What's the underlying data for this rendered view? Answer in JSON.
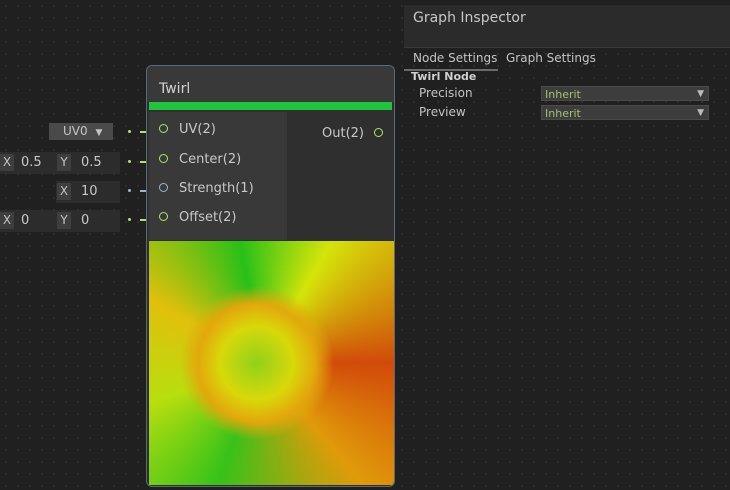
{
  "node": {
    "title": "Twirl",
    "inputs": [
      {
        "label": "UV(2)"
      },
      {
        "label": "Center(2)"
      },
      {
        "label": "Strength(1)"
      },
      {
        "label": "Offset(2)"
      }
    ],
    "output": {
      "label": "Out(2)"
    }
  },
  "inline_inputs": {
    "uv_dropdown": "UV0",
    "center": {
      "x_label": "X",
      "x_value": "0.5",
      "y_label": "Y",
      "y_value": "0.5"
    },
    "strength": {
      "x_label": "X",
      "x_value": "10"
    },
    "offset": {
      "x_label": "X",
      "x_value": "0",
      "y_label": "Y",
      "y_value": "0"
    }
  },
  "inspector": {
    "title": "Graph Inspector",
    "tabs": [
      "Node Settings",
      "Graph Settings"
    ],
    "active_tab": "Node Settings",
    "section": "Twirl Node",
    "properties": [
      {
        "label": "Precision",
        "value": "Inherit"
      },
      {
        "label": "Preview",
        "value": "Inherit"
      }
    ]
  },
  "colors": {
    "background": "#202020",
    "node_bar": "#1fc63d",
    "vector_port": "#b4e36b",
    "float_port": "#9db5d4"
  }
}
